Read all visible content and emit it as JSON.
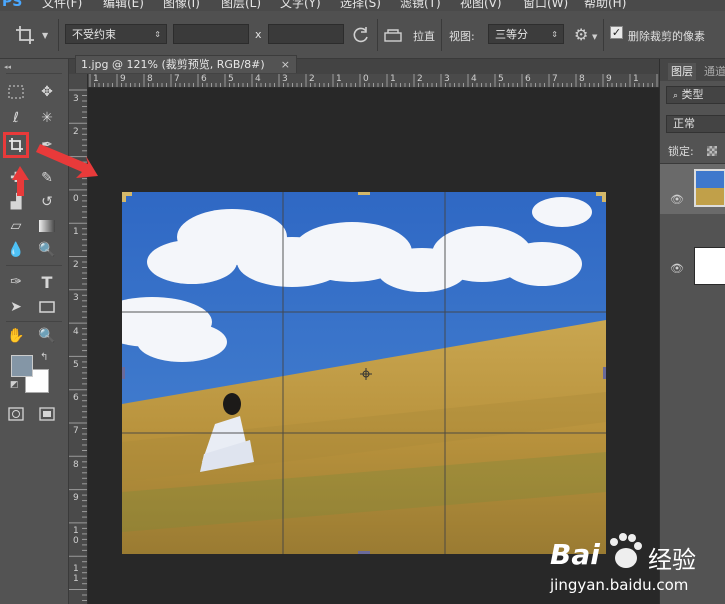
{
  "app": {
    "logo": "PS"
  },
  "menu": [
    "文件(F)",
    "编辑(E)",
    "图像(I)",
    "图层(L)",
    "文字(Y)",
    "选择(S)",
    "滤镜(T)",
    "视图(V)",
    "窗口(W)",
    "帮助(H)"
  ],
  "options": {
    "ratio_value": "不受约束",
    "x_label": "x",
    "straighten_label": "拉直",
    "view_label": "视图:",
    "view_value": "三等分",
    "delete_cropped_label": "删除裁剪的像素",
    "delete_cropped_checked": true
  },
  "document": {
    "tab_title": "1.jpg @ 121% (裁剪预览, RGB/8#)",
    "close_symbol": "×"
  },
  "rulers": {
    "horizontal": [
      "1",
      "9",
      "8",
      "7",
      "6",
      "5",
      "4",
      "3",
      "2",
      "1",
      "0",
      "1",
      "2",
      "3",
      "4",
      "5",
      "6",
      "7",
      "8",
      "9",
      "1"
    ],
    "vertical": [
      "3",
      "2",
      "1",
      "0",
      "1",
      "2",
      "3",
      "4",
      "5",
      "6",
      "7",
      "8",
      "9",
      "1 0",
      "1 1"
    ]
  },
  "layers_panel": {
    "tabs": [
      "图层",
      "通道"
    ],
    "filter_label": "类型",
    "blend_mode": "正常",
    "lock_label": "锁定:"
  },
  "watermark": {
    "brand": "Bai",
    "brand_cn": "经验",
    "url": "jingyan.baidu.com"
  },
  "colors": {
    "annotation": "#e83a3a",
    "accent": "#4aa8ff",
    "panel": "#535353",
    "canvas_bg": "#282828"
  }
}
